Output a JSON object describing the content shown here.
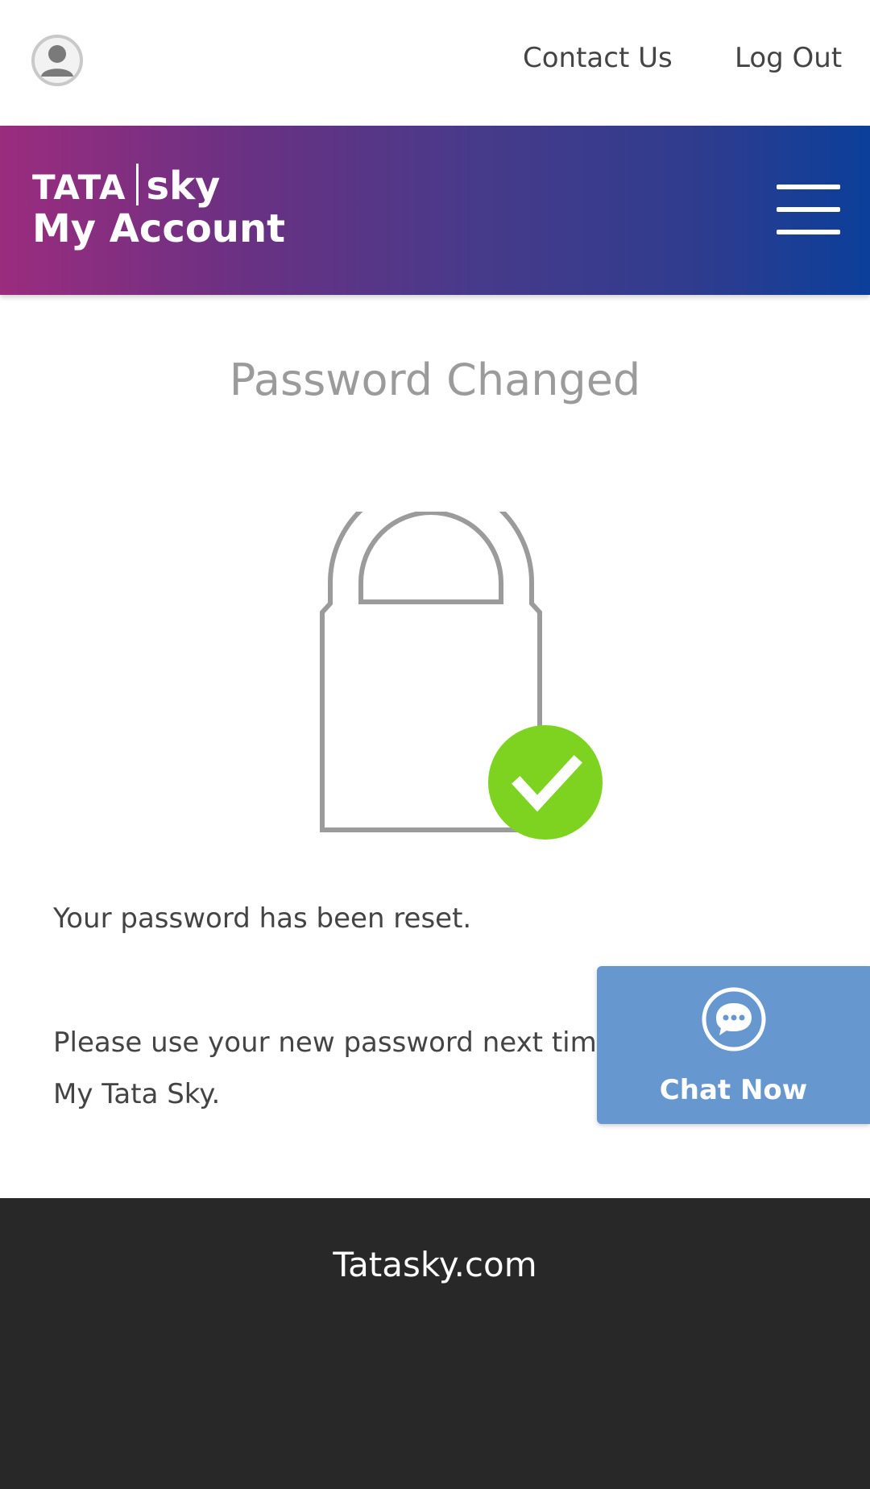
{
  "header": {
    "contact_label": "Contact Us",
    "logout_label": "Log Out"
  },
  "banner": {
    "brand_tata": "TATA",
    "brand_sky": "sky",
    "title": "My Account"
  },
  "main": {
    "title": "Password Changed",
    "message": "Your password has been reset.",
    "instruction": "Please use your new password next time you log in to My Tata Sky."
  },
  "chat": {
    "label": "Chat Now"
  },
  "footer": {
    "link": "Tatasky.com"
  },
  "colors": {
    "banner_start": "#9b2c7e",
    "banner_end": "#0b3f9a",
    "success_green": "#7ed321",
    "chat_blue": "#6797cf",
    "footer_bg": "#282828"
  },
  "icons": [
    "user-avatar-icon",
    "hamburger-menu-icon",
    "lock-icon",
    "check-icon",
    "chat-bubble-icon"
  ]
}
